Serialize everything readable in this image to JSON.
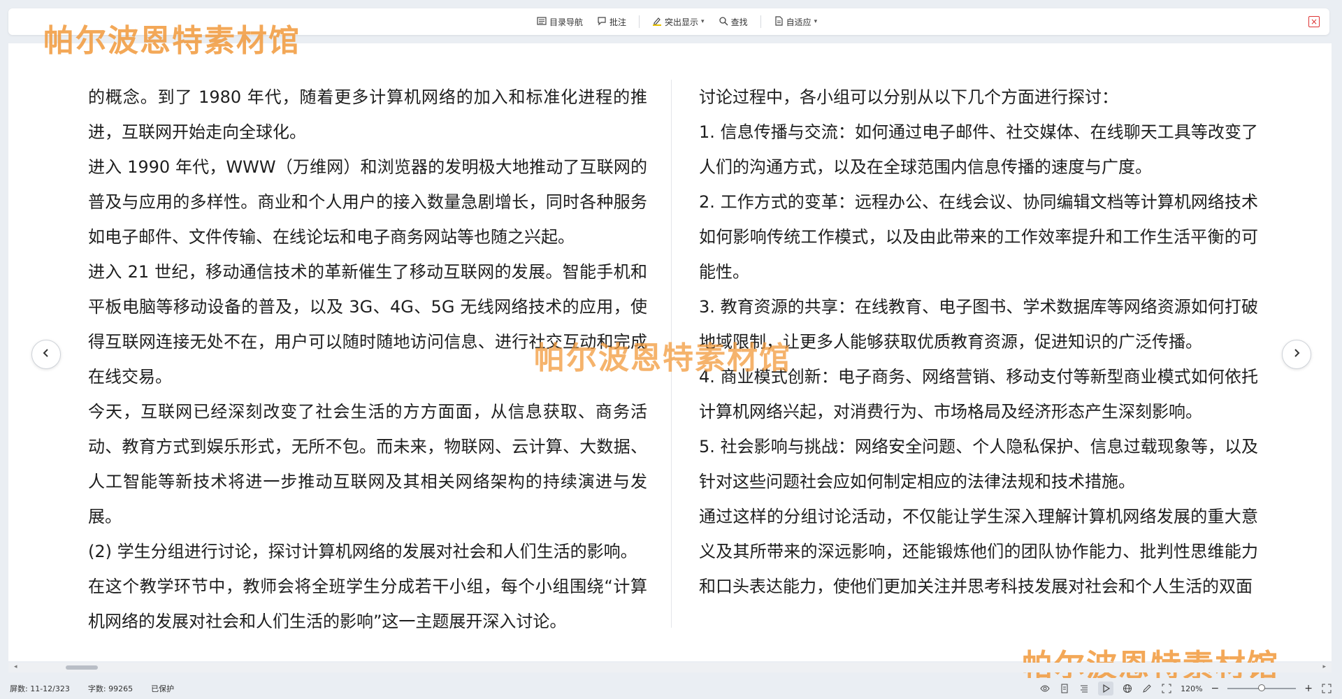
{
  "toolbar": {
    "toc_label": "目录导航",
    "comment_label": "批注",
    "highlight_label": "突出显示",
    "find_label": "查找",
    "fit_label": "自适应",
    "close_label": "×"
  },
  "watermark": {
    "text": "帕尔波恩特素材馆"
  },
  "document": {
    "left_column": [
      "的概念。到了 1980 年代，随着更多计算机网络的加入和标准化进程的推进，互联网开始走向全球化。",
      "进入 1990 年代，WWW（万维网）和浏览器的发明极大地推动了互联网的普及与应用的多样性。商业和个人用户的接入数量急剧增长，同时各种服务如电子邮件、文件传输、在线论坛和电子商务网站等也随之兴起。",
      "进入 21 世纪，移动通信技术的革新催生了移动互联网的发展。智能手机和平板电脑等移动设备的普及，以及 3G、4G、5G 无线网络技术的应用，使得互联网连接无处不在，用户可以随时随地访问信息、进行社交互动和完成在线交易。",
      "今天，互联网已经深刻改变了社会生活的方方面面，从信息获取、商务活动、教育方式到娱乐形式，无所不包。而未来，物联网、云计算、大数据、人工智能等新技术将进一步推动互联网及其相关网络架构的持续演进与发展。",
      "(2) 学生分组进行讨论，探讨计算机网络的发展对社会和人们生活的影响。",
      "在这个教学环节中，教师会将全班学生分成若干小组，每个小组围绕“计算机网络的发展对社会和人们生活的影响”这一主题展开深入讨论。"
    ],
    "right_column": [
      "讨论过程中，各小组可以分别从以下几个方面进行探讨：",
      "1. 信息传播与交流：如何通过电子邮件、社交媒体、在线聊天工具等改变了人们的沟通方式，以及在全球范围内信息传播的速度与广度。",
      "2. 工作方式的变革：远程办公、在线会议、协同编辑文档等计算机网络技术如何影响传统工作模式，以及由此带来的工作效率提升和工作生活平衡的可能性。",
      "3. 教育资源的共享：在线教育、电子图书、学术数据库等网络资源如何打破地域限制，让更多人能够获取优质教育资源，促进知识的广泛传播。",
      "4. 商业模式创新：电子商务、网络营销、移动支付等新型商业模式如何依托计算机网络兴起，对消费行为、市场格局及经济形态产生深刻影响。",
      "5. 社会影响与挑战：网络安全问题、个人隐私保护、信息过载现象等，以及针对这些问题社会应如何制定相应的法律法规和技术措施。",
      "通过这样的分组讨论活动，不仅能让学生深入理解计算机网络发展的重大意义及其所带来的深远影响，还能锻炼他们的团队协作能力、批判性思维能力和口头表达能力，使他们更加关注并思考科技发展对社会和个人生活的双面"
    ]
  },
  "status": {
    "screen": "屏数: 11-12/323",
    "word_count": "字数: 99265",
    "protected": "已保护",
    "zoom": "120%",
    "zoom_level": 0.5
  },
  "icons": [
    "toc-icon",
    "comment-icon",
    "highlight-icon",
    "search-icon",
    "fit-page-icon",
    "close-icon",
    "prev-page-icon",
    "next-page-icon",
    "eye-icon",
    "page-view-icon",
    "list-view-icon",
    "play-icon",
    "web-icon",
    "pen-icon",
    "fit-screen-icon"
  ]
}
